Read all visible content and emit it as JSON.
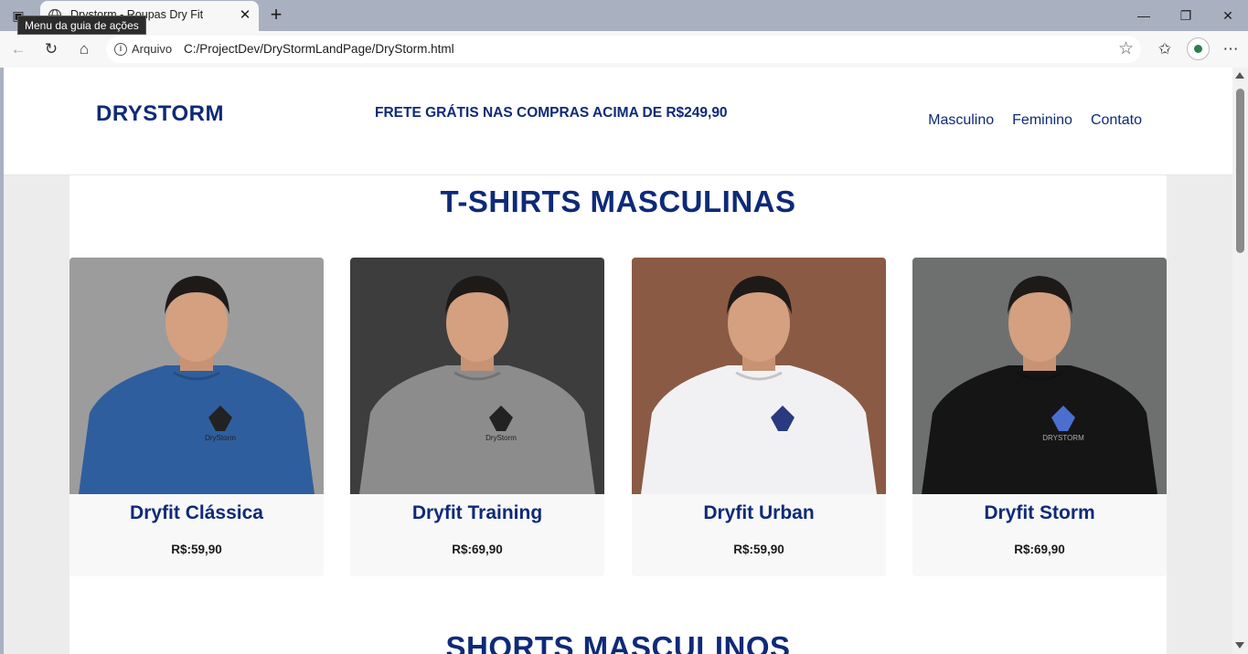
{
  "browser": {
    "tab_title": "Drystorm - Roupas Dry Fit",
    "tooltip": "Menu da guia de ações",
    "address_scheme": "Arquivo",
    "address_url": "C:/ProjectDev/DryStormLandPage/DryStorm.html"
  },
  "header": {
    "logo": "DRYSTORM",
    "promo": "FRETE GRÁTIS NAS COMPRAS ACIMA DE R$249,90",
    "nav": [
      "Masculino",
      "Feminino",
      "Contato"
    ]
  },
  "sections": [
    {
      "title": "T-SHIRTS MASCULINAS",
      "products": [
        {
          "name": "Dryfit Clássica",
          "price": "R$:59,90",
          "shirt_color": "#2f5e9e",
          "bg_color": "#9c9c9c",
          "logo_text": "DryStorm"
        },
        {
          "name": "Dryfit Training",
          "price": "R$:69,90",
          "shirt_color": "#8c8c8c",
          "bg_color": "#3d3d3d",
          "logo_text": "DryStorm"
        },
        {
          "name": "Dryfit Urban",
          "price": "R$:59,90",
          "shirt_color": "#f1f1f4",
          "bg_color": "#8a5a44",
          "logo_text": ""
        },
        {
          "name": "Dryfit Storm",
          "price": "R$:69,90",
          "shirt_color": "#151515",
          "bg_color": "#6e7070",
          "logo_text": "DRYSTORM"
        }
      ]
    },
    {
      "title": "SHORTS MASCULINOS"
    }
  ]
}
